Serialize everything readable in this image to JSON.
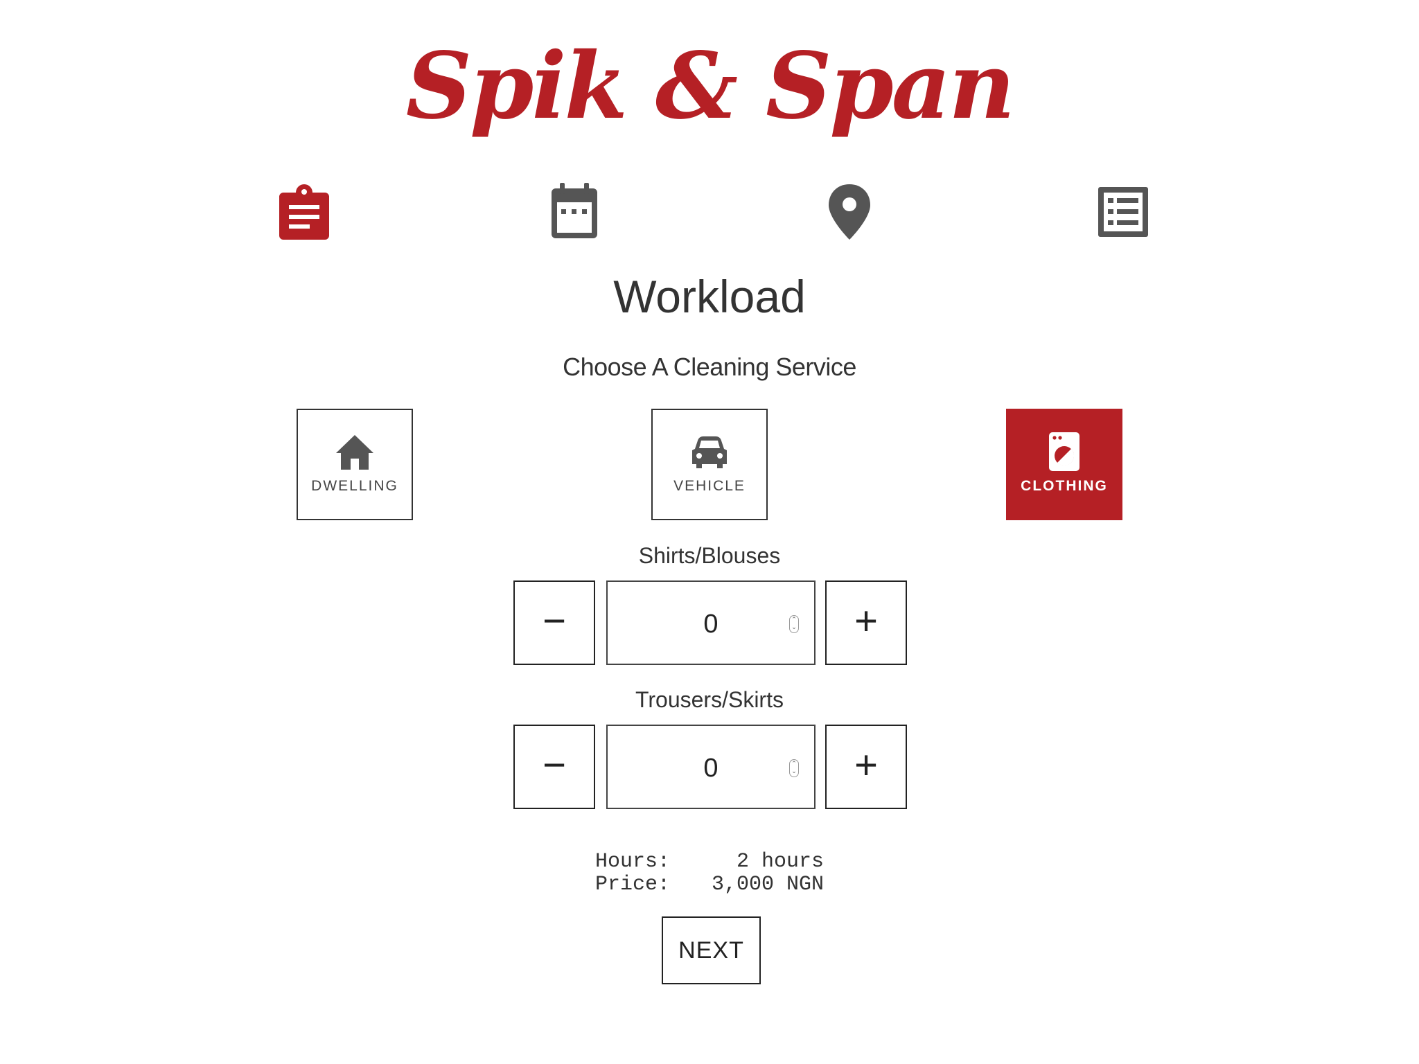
{
  "brand": {
    "logo_text": "Spik & Span",
    "accent_color": "#b52025"
  },
  "steps": [
    {
      "icon": "clipboard-icon",
      "active": true
    },
    {
      "icon": "calendar-icon",
      "active": false
    },
    {
      "icon": "map-pin-icon",
      "active": false
    },
    {
      "icon": "list-icon",
      "active": false
    }
  ],
  "page": {
    "title": "Workload",
    "subtitle": "Choose A Cleaning Service"
  },
  "services": [
    {
      "label": "DWELLING",
      "icon": "house-icon",
      "selected": false
    },
    {
      "label": "VEHICLE",
      "icon": "car-icon",
      "selected": false
    },
    {
      "label": "CLOTHING",
      "icon": "washing-machine-icon",
      "selected": true
    }
  ],
  "items": [
    {
      "label": "Shirts/Blouses",
      "value": "0",
      "minus": "−",
      "plus": "+"
    },
    {
      "label": "Trousers/Skirts",
      "value": "0",
      "minus": "−",
      "plus": "+"
    }
  ],
  "summary": {
    "hours_label": "Hours:",
    "hours_value": "2 hours",
    "price_label": "Price:",
    "price_value": "3,000 NGN"
  },
  "next_button": {
    "label": "NEXT"
  }
}
